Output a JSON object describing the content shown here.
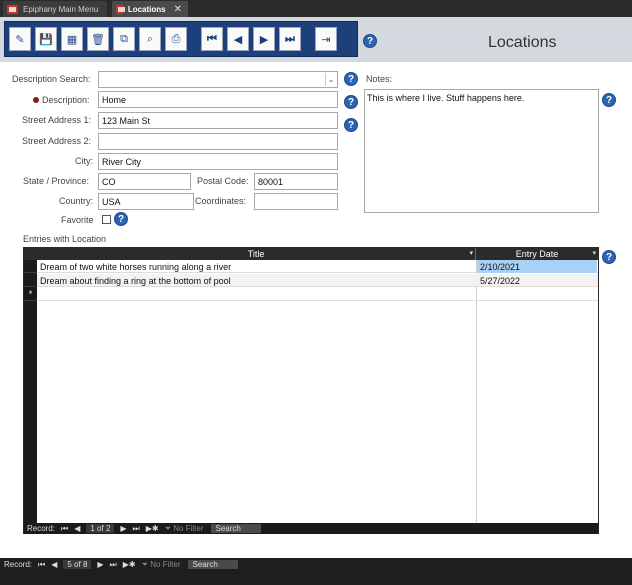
{
  "tabs": [
    {
      "label": "Epiphany Main Menu",
      "active": false
    },
    {
      "label": "Locations",
      "active": true
    }
  ],
  "toolbar": {
    "buttons": [
      {
        "icon": "new-record-icon",
        "glyph": "✎"
      },
      {
        "icon": "save-icon",
        "glyph": "💾"
      },
      {
        "icon": "calendar-icon",
        "glyph": "▦"
      },
      {
        "icon": "delete-icon",
        "glyph": "🗑"
      },
      {
        "icon": "copy-icon",
        "glyph": "⧉"
      },
      {
        "icon": "binoculars-icon",
        "glyph": "⌕"
      },
      {
        "icon": "print-icon",
        "glyph": "⎙"
      },
      {
        "icon": "first-record-icon",
        "glyph": "⏮"
      },
      {
        "icon": "previous-record-icon",
        "glyph": "◀"
      },
      {
        "icon": "next-record-icon",
        "glyph": "▶"
      },
      {
        "icon": "last-record-icon",
        "glyph": "⏭"
      },
      {
        "icon": "close-form-icon",
        "glyph": "⇥"
      }
    ]
  },
  "page_title": "Locations",
  "form": {
    "description_search": {
      "label": "Description Search:",
      "value": ""
    },
    "description": {
      "label": "Description:",
      "value": "Home"
    },
    "street1": {
      "label": "Street Address 1:",
      "value": "123 Main St"
    },
    "street2": {
      "label": "Street Address 2:",
      "value": ""
    },
    "city": {
      "label": "City:",
      "value": "River City"
    },
    "state": {
      "label": "State / Province:",
      "value": "CO"
    },
    "postal": {
      "label": "Postal Code:",
      "value": "80001"
    },
    "country": {
      "label": "Country:",
      "value": "USA"
    },
    "coordinates": {
      "label": "Coordinates:",
      "value": ""
    },
    "favorite": {
      "label": "Favorite",
      "checked": false
    },
    "notes": {
      "label": "Notes:",
      "value": "This is where I live. Stuff happens here."
    }
  },
  "entries": {
    "label": "Entries with Location",
    "columns": [
      "Title",
      "Entry Date"
    ],
    "rows": [
      {
        "title": "Dream of two white horses running along a river",
        "date": "2/10/2021"
      },
      {
        "title": "Dream about finding a ring at the bottom of pool",
        "date": "5/27/2022"
      }
    ],
    "new_row_marker": "*",
    "nav": {
      "record_label": "Record:",
      "position": "1 of 2",
      "filter": "No Filter",
      "search": "Search"
    }
  },
  "form_nav": {
    "record_label": "Record:",
    "position": "5 of 8",
    "filter": "No Filter",
    "search": "Search"
  },
  "help_glyph": "?",
  "colors": {
    "toolbar_bg": "#1d3f7a",
    "help_icon": "#2d63b0",
    "required_dot": "#8b1a1a",
    "selected_cell": "#a9d1f5"
  }
}
